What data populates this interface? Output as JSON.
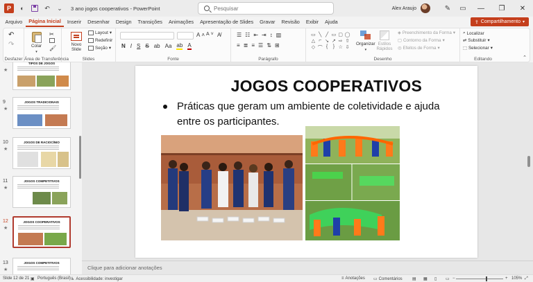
{
  "window": {
    "doc_title": "3 ano jogos cooperativos  -  PowerPoint",
    "user_name": "Alex Araujo",
    "app_badge": "P"
  },
  "search": {
    "placeholder": "Pesquisar"
  },
  "menu": {
    "tabs": [
      "Arquivo",
      "Página Inicial",
      "Inserir",
      "Desenhar",
      "Design",
      "Transições",
      "Animações",
      "Apresentação de Slides",
      "Gravar",
      "Revisão",
      "Exibir",
      "Ajuda"
    ],
    "active_index": 1,
    "share_label": "Compartilhamento"
  },
  "ribbon": {
    "undo_group": "Desfazer",
    "clipboard": {
      "paste": "Colar",
      "label": "Área de Transferência"
    },
    "slides": {
      "new_slide": "Novo Slide",
      "layout": "Layout",
      "reset": "Redefinir",
      "section": "Seção",
      "label": "Slides"
    },
    "font": {
      "label": "Fonte",
      "bold": "N",
      "italic": "I",
      "underline": "S",
      "strike": "S",
      "size_up": "A",
      "size_down": "A"
    },
    "paragraph": {
      "label": "Parágrafo"
    },
    "drawing": {
      "arrange": "Organizar",
      "quick_styles": "Estilos Rápidos",
      "fill": "Preenchimento da Forma",
      "outline": "Contorno da Forma",
      "effects": "Efeitos de Forma",
      "label": "Desenho"
    },
    "editing": {
      "find": "Localizar",
      "replace": "Substituir",
      "select": "Selecionar",
      "label": "Editando"
    }
  },
  "thumbnails": [
    {
      "num": "",
      "title": "TIPOS DE JOGOS",
      "selected": false
    },
    {
      "num": "9",
      "title": "JOGOS TRADICIONAIS",
      "selected": false
    },
    {
      "num": "10",
      "title": "JOGOS DE RACIOCÍNIO",
      "selected": false
    },
    {
      "num": "11",
      "title": "JOGOS COMPETITIVOS",
      "selected": false
    },
    {
      "num": "12",
      "title": "JOGOS COOPERATIVOS",
      "selected": true
    },
    {
      "num": "13",
      "title": "JOGOS COMPETITIVOS",
      "selected": false
    }
  ],
  "slide": {
    "title": "JOGOS COOPERATIVOS",
    "bullet": "Práticas que geram um ambiente de coletividade e ajuda entre os participantes."
  },
  "notes_placeholder": "Clique para adicionar anotações",
  "status": {
    "slide_count": "Slide 12 de 21",
    "language": "Português (Brasil)",
    "accessibility": "Acessibilidade: investigar",
    "notes": "Anotações",
    "comments": "Comentários",
    "zoom": "105%"
  },
  "colors": {
    "accent": "#c43e1c",
    "selected_thumb_border": "#b03a2e"
  }
}
